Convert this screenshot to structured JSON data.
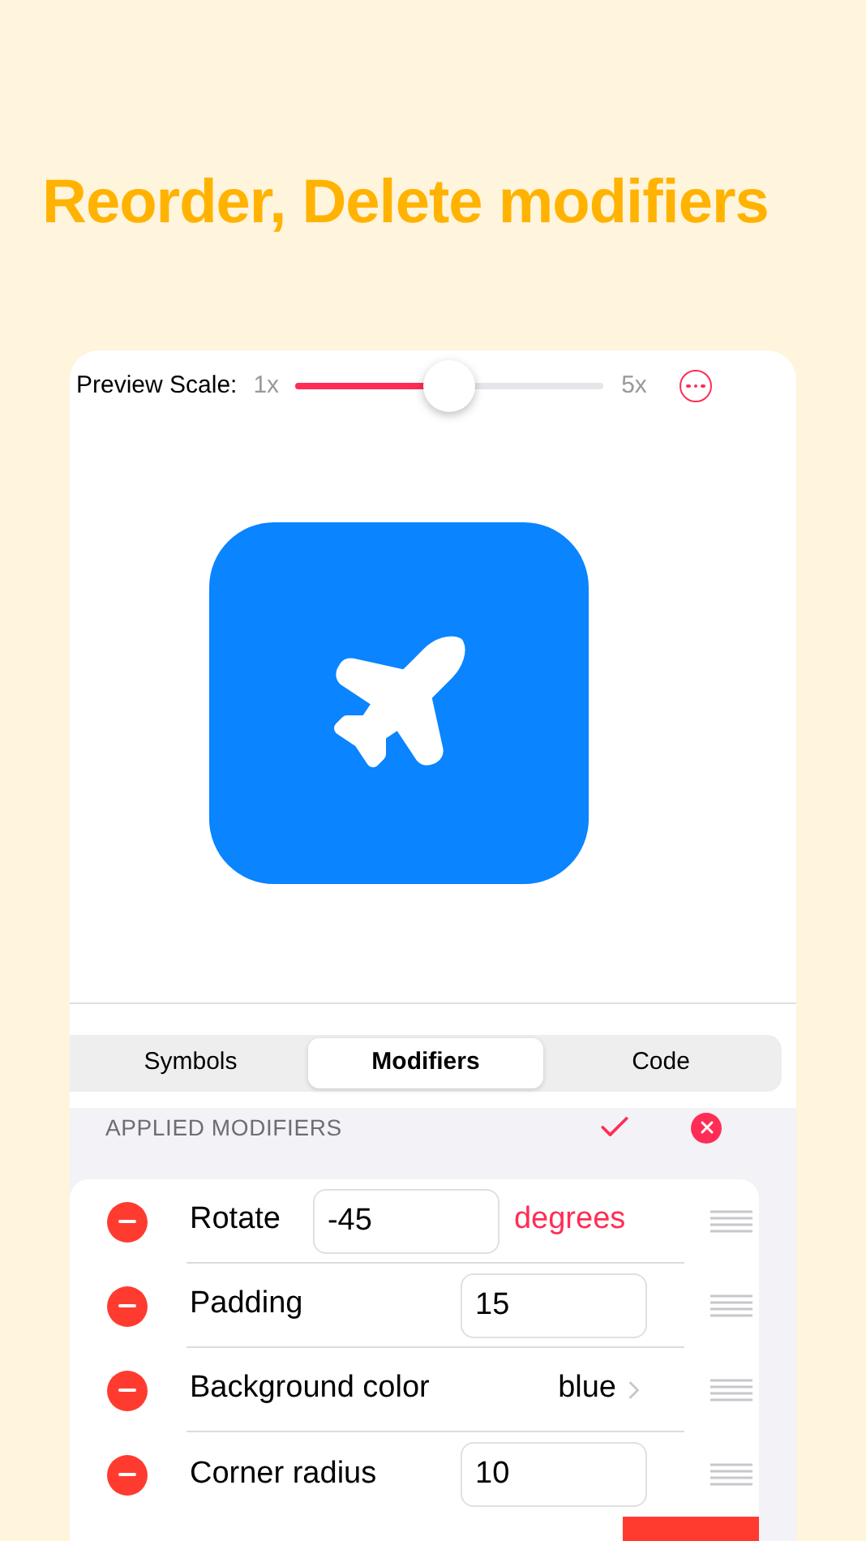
{
  "headline": "Reorder, Delete modifiers",
  "preview": {
    "label": "Preview Scale:",
    "min_label": "1x",
    "max_label": "5x",
    "level": 0.5
  },
  "tabs": [
    {
      "label": "Symbols",
      "selected": false
    },
    {
      "label": "Modifiers",
      "selected": true
    },
    {
      "label": "Code",
      "selected": false
    }
  ],
  "section": {
    "title": "APPLIED MODIFIERS"
  },
  "modifiers": [
    {
      "kind": "field",
      "name": "Rotate",
      "value": "-45",
      "unit": "degrees"
    },
    {
      "kind": "field",
      "name": "Padding",
      "value": "15"
    },
    {
      "kind": "picker",
      "name": "Background color",
      "value": "blue"
    },
    {
      "kind": "field",
      "name": "Corner radius",
      "value": "10"
    }
  ]
}
